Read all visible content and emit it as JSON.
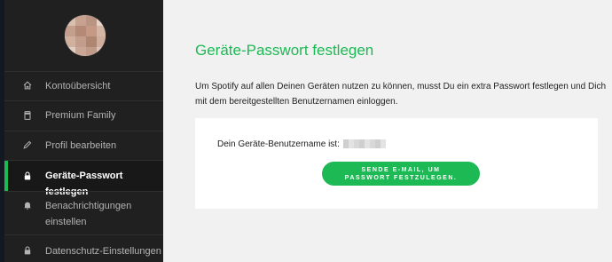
{
  "sidebar": {
    "items": [
      {
        "label": "Kontoübersicht",
        "icon": "home-icon",
        "active": false
      },
      {
        "label": "Premium Family",
        "icon": "device-icon",
        "active": false
      },
      {
        "label": "Profil bearbeiten",
        "icon": "pencil-icon",
        "active": false
      },
      {
        "label": "Geräte-Passwort festlegen",
        "icon": "lock-icon",
        "active": true
      },
      {
        "label": "Benachrichtigungen\neinstellen",
        "icon": "bell-icon",
        "active": false
      },
      {
        "label": "Datenschutz-Einstellungen",
        "icon": "lock-icon",
        "active": false
      }
    ]
  },
  "main": {
    "title": "Geräte-Passwort festlegen",
    "intro": "Um Spotify auf allen Deinen Geräten nutzen zu können, musst Du ein extra Passwort festlegen und Dich mit dem bereitgestellten Benutzernamen einloggen.",
    "username_label": "Dein Geräte-Benutzername ist:",
    "button_label": "SENDE E-MAIL, UM\nPASSWORT FESTZULEGEN."
  },
  "colors": {
    "accent": "#1db954",
    "sidebar_bg": "#202020",
    "page_bg": "#f1f1f1"
  }
}
